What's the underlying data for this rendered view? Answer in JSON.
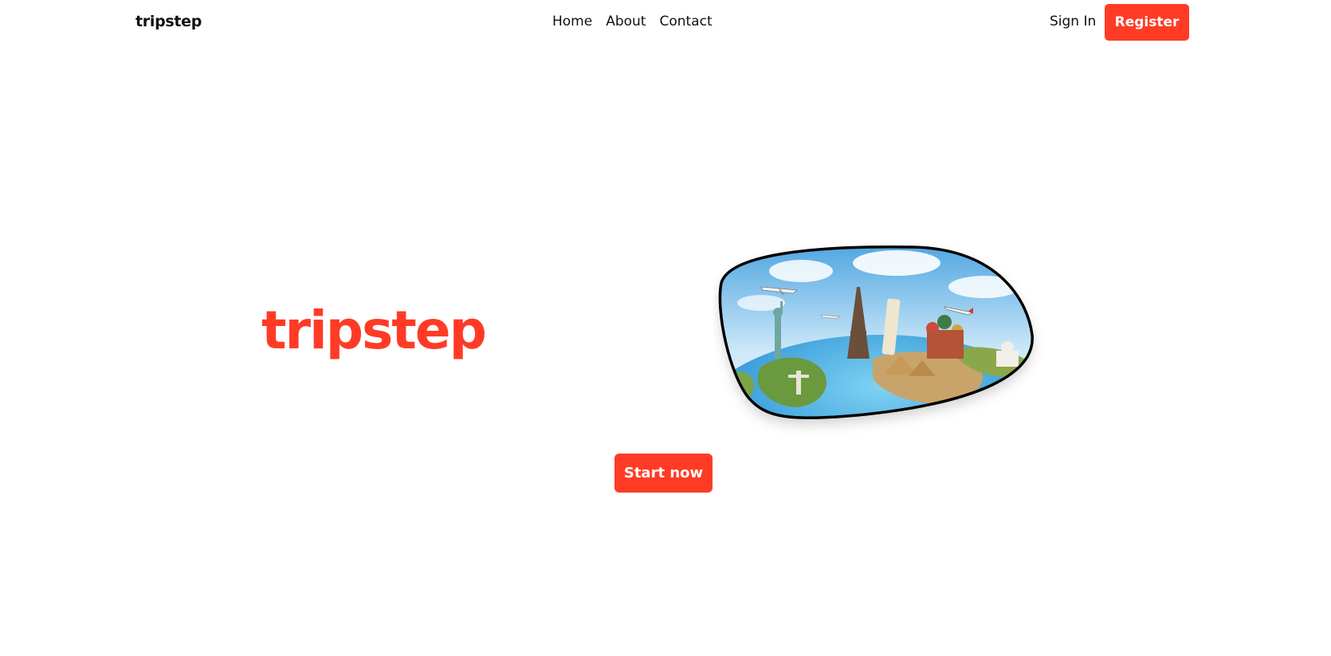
{
  "nav": {
    "brand": "tripstep",
    "links": [
      "Home",
      "About",
      "Contact"
    ],
    "sign_in": "Sign In",
    "register": "Register"
  },
  "hero": {
    "title": "tripstep",
    "cta": "Start now",
    "image_icon": "world-landmarks-globe-illustration"
  },
  "colors": {
    "accent": "#FF3B26",
    "text": "#111111",
    "background": "#FFFFFF"
  }
}
